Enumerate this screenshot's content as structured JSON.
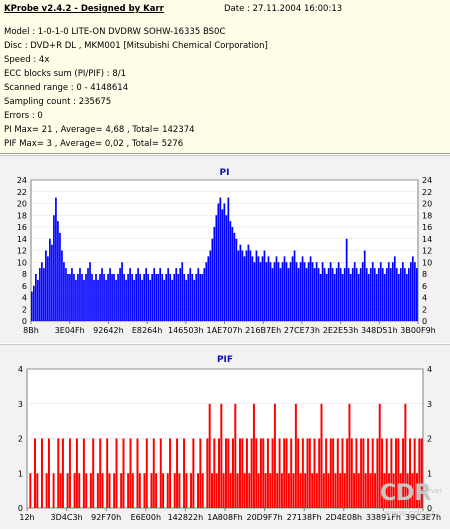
{
  "info": {
    "title": "KProbe v2.4.2 - Designed by Karr",
    "date": "Date : 27.11.2004 16:00:13",
    "lines": [
      "Model : 1-0-1-0 LITE-ON DVDRW SOHW-16335 BS0C",
      "Disc : DVD+R DL , MKM001 [Mitsubishi Chemical Corporation]",
      "Speed : 4x",
      "ECC blocks sum (PI/PIF) : 8/1",
      "Scanned range : 0 - 4148614",
      "Sampling count : 235675",
      "Errors : 0",
      "PI Max= 21 , Average= 4,68 , Total= 142374",
      "PIF Max= 3 , Average= 0,02 , Total= 5276"
    ]
  },
  "watermark": {
    "logo": "CDR",
    "sub": "server",
    "url": "www.cdr.cz"
  },
  "colors": {
    "pi_bar": "#0000ff",
    "pif_bar": "#ff0000",
    "plot_bg": "#ffffff",
    "grid": "#c0c0c0",
    "title": "#1010c0"
  },
  "chart_data": [
    {
      "type": "bar",
      "title": "PI",
      "xlabel": "",
      "ylabel": "",
      "ylim": [
        0,
        24
      ],
      "yticks": [
        0,
        2,
        4,
        6,
        8,
        10,
        12,
        14,
        16,
        18,
        20,
        22,
        24
      ],
      "xtick_labels": [
        "8Bh",
        "3E04Fh",
        "92642h",
        "E8264h",
        "146503h",
        "1AE707h",
        "216B7Eh",
        "27CE73h",
        "2E2E53h",
        "348D51h",
        "3B00F9h"
      ],
      "grid": true,
      "series": [
        {
          "values": [
            5,
            6,
            8,
            7,
            9,
            10,
            9,
            12,
            11,
            14,
            13,
            18,
            21,
            17,
            15,
            12,
            10,
            9,
            8,
            8,
            9,
            8,
            7,
            8,
            9,
            8,
            7,
            8,
            9,
            10,
            8,
            7,
            8,
            7,
            8,
            9,
            8,
            7,
            8,
            9,
            8,
            8,
            7,
            8,
            9,
            10,
            8,
            7,
            8,
            9,
            8,
            7,
            8,
            9,
            8,
            7,
            8,
            9,
            8,
            7,
            8,
            9,
            8,
            8,
            9,
            8,
            7,
            8,
            9,
            8,
            7,
            8,
            9,
            8,
            9,
            10,
            8,
            7,
            8,
            9,
            8,
            7,
            8,
            9,
            8,
            8,
            9,
            10,
            11,
            12,
            14,
            16,
            18,
            20,
            21,
            19,
            20,
            18,
            21,
            17,
            16,
            15,
            14,
            12,
            13,
            12,
            11,
            12,
            13,
            12,
            11,
            10,
            12,
            11,
            10,
            11,
            12,
            10,
            11,
            10,
            9,
            10,
            11,
            10,
            9,
            10,
            11,
            10,
            9,
            10,
            11,
            12,
            10,
            9,
            10,
            11,
            10,
            9,
            10,
            11,
            10,
            9,
            10,
            9,
            8,
            10,
            9,
            8,
            9,
            10,
            9,
            8,
            9,
            10,
            9,
            8,
            9,
            14,
            9,
            8,
            9,
            10,
            9,
            8,
            9,
            10,
            12,
            9,
            8,
            9,
            10,
            9,
            8,
            9,
            10,
            9,
            8,
            9,
            10,
            9,
            10,
            11,
            9,
            8,
            9,
            10,
            9,
            8,
            9,
            10,
            11,
            10,
            9
          ]
        }
      ]
    },
    {
      "type": "bar",
      "title": "PIF",
      "xlabel": "",
      "ylabel": "",
      "ylim": [
        0,
        4
      ],
      "yticks": [
        0,
        1,
        2,
        3,
        4
      ],
      "xtick_labels": [
        "12h",
        "3D4C3h",
        "92F70h",
        "E6E00h",
        "142822h",
        "1A808Fh",
        "20D9F7h",
        "27138Fh",
        "2D4E08h",
        "33891Fh",
        "39C3E7h"
      ],
      "grid": true,
      "series": [
        {
          "values": [
            0,
            1,
            0,
            2,
            1,
            0,
            2,
            0,
            1,
            2,
            0,
            1,
            0,
            2,
            1,
            2,
            0,
            1,
            2,
            0,
            1,
            2,
            1,
            0,
            2,
            1,
            0,
            1,
            2,
            0,
            1,
            2,
            1,
            0,
            2,
            1,
            0,
            1,
            2,
            0,
            1,
            2,
            0,
            1,
            2,
            1,
            0,
            2,
            1,
            0,
            1,
            2,
            0,
            1,
            2,
            1,
            0,
            2,
            1,
            0,
            1,
            2,
            0,
            1,
            2,
            1,
            0,
            2,
            1,
            0,
            1,
            2,
            0,
            1,
            2,
            1,
            0,
            2,
            3,
            1,
            2,
            1,
            2,
            3,
            1,
            2,
            2,
            1,
            2,
            3,
            1,
            2,
            2,
            1,
            2,
            1,
            2,
            3,
            2,
            1,
            2,
            2,
            1,
            2,
            1,
            2,
            3,
            1,
            2,
            1,
            2,
            2,
            1,
            2,
            1,
            3,
            2,
            1,
            2,
            1,
            2,
            2,
            1,
            2,
            1,
            2,
            3,
            1,
            2,
            1,
            2,
            2,
            1,
            2,
            1,
            2,
            1,
            2,
            3,
            2,
            1,
            2,
            1,
            2,
            2,
            1,
            2,
            1,
            2,
            1,
            2,
            3,
            2,
            1,
            2,
            1,
            2,
            1,
            2,
            2,
            1,
            2,
            3,
            1,
            2,
            1,
            2,
            1,
            2,
            2
          ]
        }
      ]
    }
  ]
}
